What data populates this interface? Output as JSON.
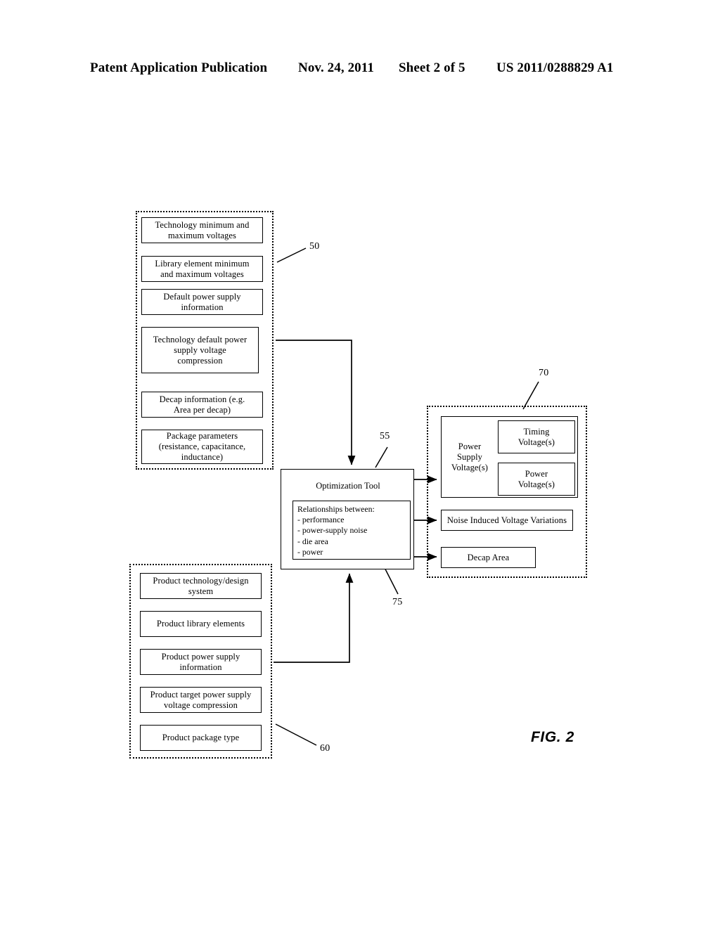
{
  "header": {
    "title": "Patent Application Publication",
    "date": "Nov. 24, 2011",
    "sheet": "Sheet 2 of 5",
    "publication_number": "US 2011/0288829 A1"
  },
  "figure": {
    "label": "FIG. 2"
  },
  "technology_inputs": {
    "ref": "50",
    "boxes": [
      {
        "label": "Technology minimum and\nmaximum voltages"
      },
      {
        "label": "Library element minimum\nand maximum voltages"
      },
      {
        "label": "Default power supply\ninformation"
      },
      {
        "label": "Technology default power\nsupply voltage\ncompression"
      },
      {
        "label": "Decap information (e.g.\nArea per decap)"
      },
      {
        "label": "Package parameters\n(resistance, capacitance,\ninductance)"
      }
    ]
  },
  "product_inputs": {
    "ref": "60",
    "boxes": [
      {
        "label": "Product  technology/design\nsystem"
      },
      {
        "label": "Product library elements"
      },
      {
        "label": "Product power supply\ninformation"
      },
      {
        "label": "Product target power supply\nvoltage compression"
      },
      {
        "label": "Product package type"
      }
    ]
  },
  "optimization_tool": {
    "ref": "55",
    "title": "Optimization Tool",
    "relationships_ref": "75",
    "relationships": "Relationships between:\n - performance\n- power-supply noise\n- die area\n- power"
  },
  "outputs": {
    "ref": "70",
    "power_supply": {
      "label": "Power\nSupply\nVoltage(s)",
      "children": [
        {
          "label": "Timing\nVoltage(s)"
        },
        {
          "label": "Power\nVoltage(s)"
        }
      ]
    },
    "noise": {
      "label": "Noise Induced Voltage Variations"
    },
    "decap": {
      "label": "Decap Area"
    }
  },
  "colors": {
    "ink": "#000000",
    "paper": "#ffffff"
  }
}
